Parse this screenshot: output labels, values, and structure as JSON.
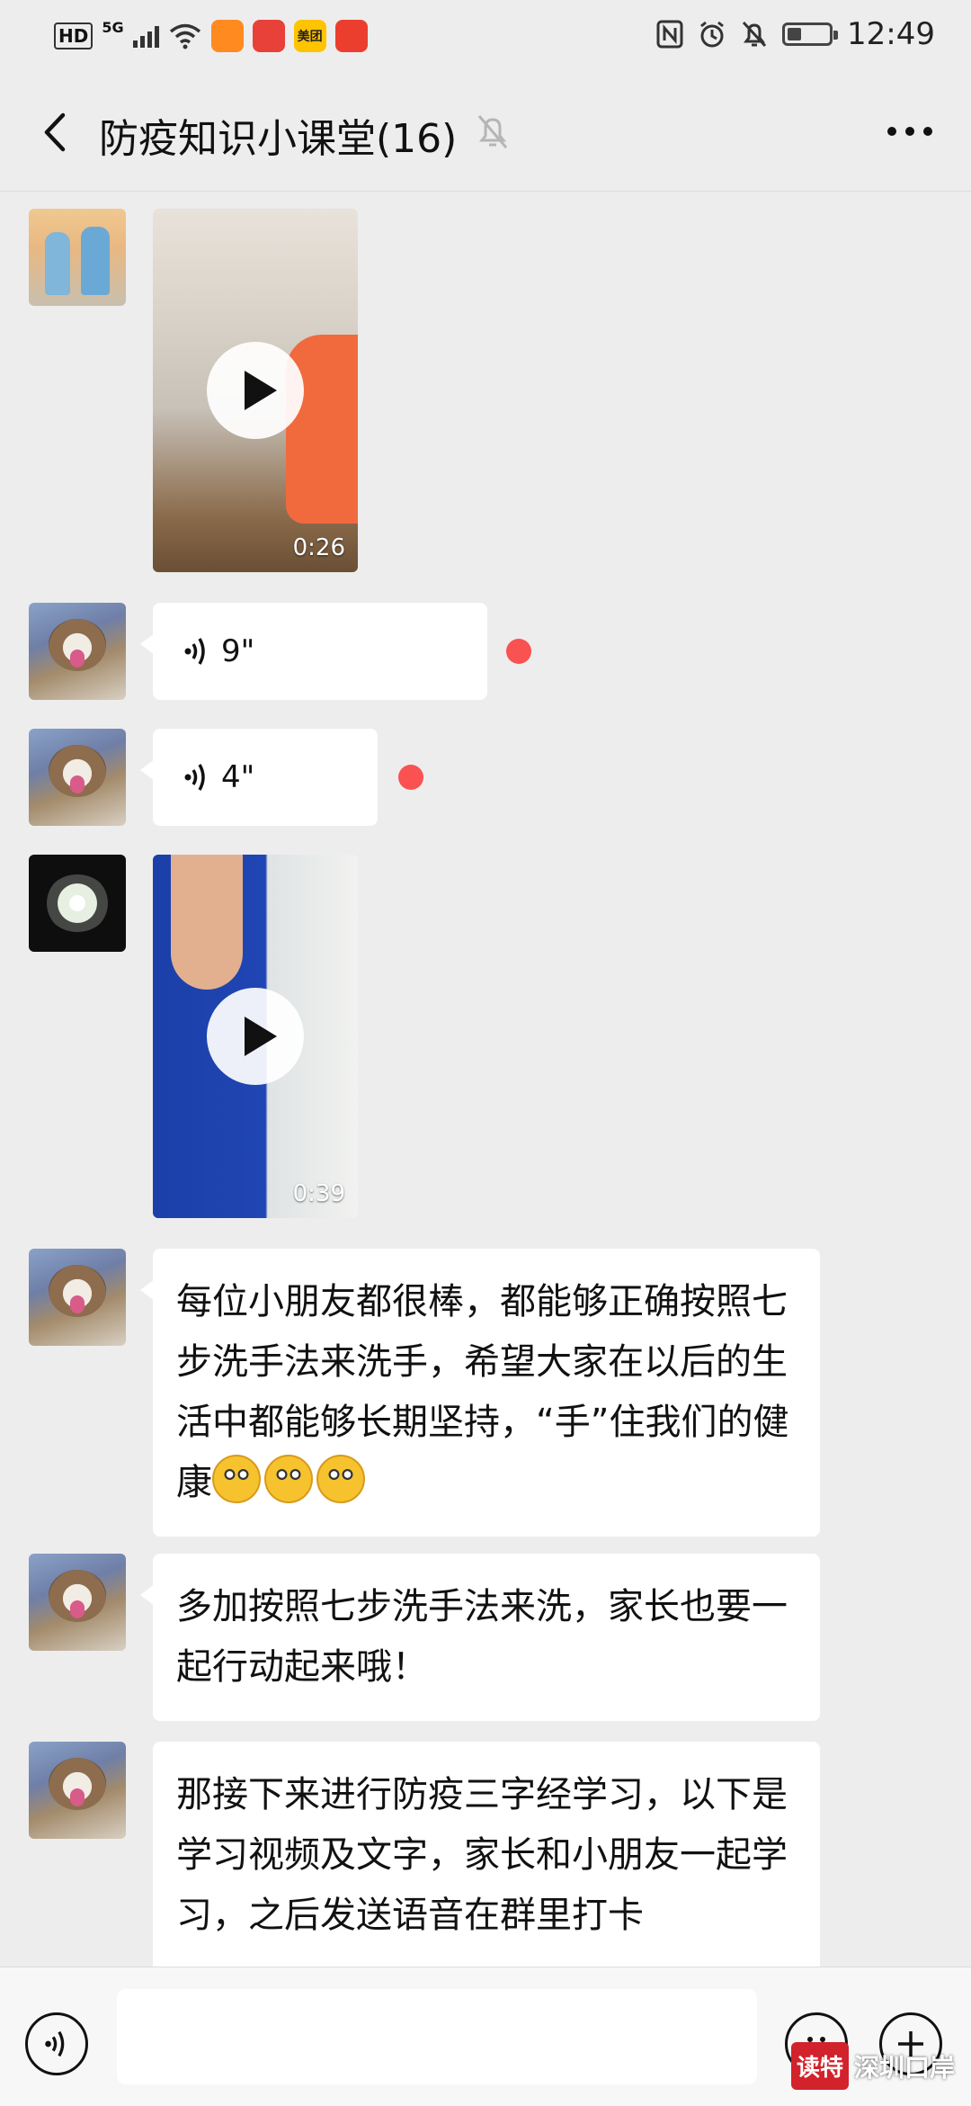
{
  "status_bar": {
    "hd": "HD",
    "network": "5G",
    "app_icons": [
      {
        "name": "taobao-app-icon",
        "label": "",
        "color": "#ff8a1f"
      },
      {
        "name": "reader-app-icon",
        "label": "",
        "color": "#e8413a"
      },
      {
        "name": "meituan-app-icon",
        "label": "美团",
        "color": "#ffc400"
      },
      {
        "name": "shop-app-icon",
        "label": "",
        "color": "#ec3e2e"
      }
    ],
    "time": "12:49",
    "battery_level": 0.35
  },
  "header": {
    "title": "防疫知识小课堂(16)"
  },
  "messages": [
    {
      "type": "video",
      "avatar": "kids-photo",
      "duration": "0:26"
    },
    {
      "type": "voice",
      "avatar": "cat-photo",
      "length": "9\"",
      "unread": true
    },
    {
      "type": "voice",
      "avatar": "cat-photo",
      "length": "4\"",
      "unread": true
    },
    {
      "type": "video",
      "avatar": "flower-photo",
      "duration": "0:39"
    },
    {
      "type": "text",
      "avatar": "cat-photo",
      "text": "每位小朋友都很棒，都能够正确按照七步洗手法来洗手，希望大家在以后的生活中都能够长期坚持，“手”住我们的健康",
      "emoji_count": 3
    },
    {
      "type": "text",
      "avatar": "cat-photo",
      "text": "多加按照七步洗手法来洗，家长也要一起行动起来哦！"
    },
    {
      "type": "text",
      "avatar": "cat-photo",
      "text": "那接下来进行防疫三字经学习，以下是学习视频及文字，家长和小朋友一起学习，之后发送语音在群里打卡"
    }
  ],
  "input_bar": {
    "value": "",
    "watermark_logo": "读特",
    "watermark_text": "深圳口岸"
  },
  "colors": {
    "background": "#ededed",
    "bubble": "#ffffff",
    "unread_dot": "#fa5151"
  }
}
